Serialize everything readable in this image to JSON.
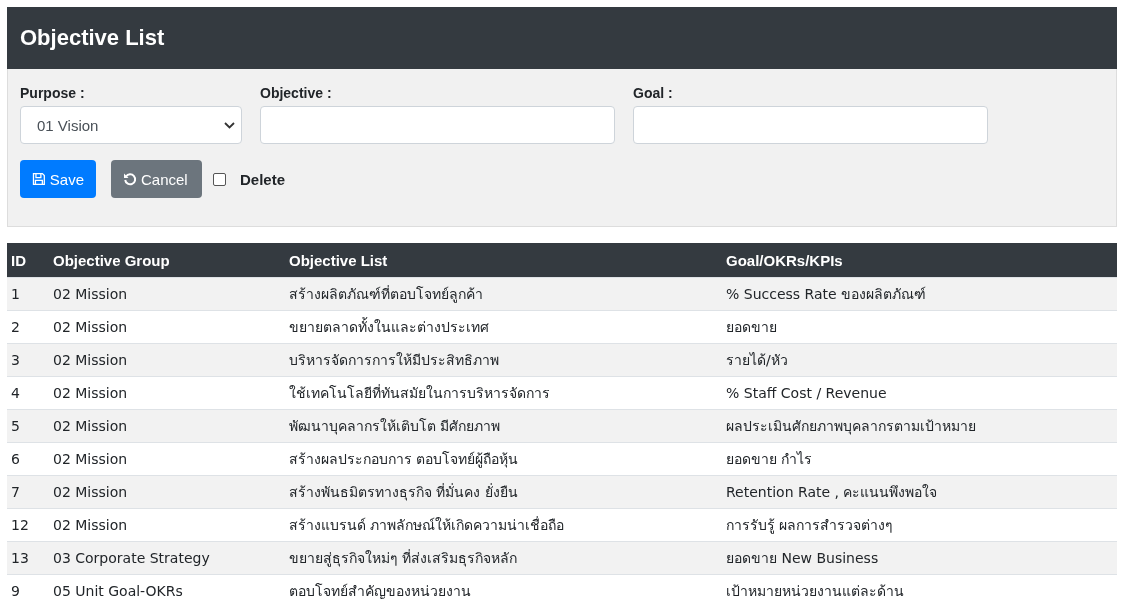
{
  "header": {
    "title": "Objective List"
  },
  "form": {
    "purpose": {
      "label": "Purpose :",
      "value": "01 Vision"
    },
    "objective": {
      "label": "Objective :"
    },
    "goal": {
      "label": "Goal :"
    },
    "save_button": "Save",
    "cancel_button": "Cancel",
    "delete": {
      "label": "Delete",
      "checked": false
    }
  },
  "table": {
    "columns": [
      "ID",
      "Objective Group",
      "Objective List",
      "Goal/OKRs/KPIs"
    ],
    "rows": [
      [
        "1",
        "02 Mission",
        "สร้างผลิตภัณฑ์ที่ตอบโจทย์ลูกค้า",
        "% Success Rate ของผลิตภัณฑ์"
      ],
      [
        "2",
        "02 Mission",
        "ขยายตลาดทั้งในและต่างประเทศ",
        "ยอดขาย"
      ],
      [
        "3",
        "02 Mission",
        "บริหารจัดการการให้มีประสิทธิภาพ",
        "รายได้/หัว"
      ],
      [
        "4",
        "02 Mission",
        "ใช้เทคโนโลยีที่ทันสมัยในการบริหารจัดการ",
        "% Staff Cost / Revenue"
      ],
      [
        "5",
        "02 Mission",
        "พัฒนาบุคลากรให้เติบโต มีศักยภาพ",
        "ผลประเมินศักยภาพบุคลากรตามเป้าหมาย"
      ],
      [
        "6",
        "02 Mission",
        "สร้างผลประกอบการ ตอบโจทย์ผู้ถือหุ้น",
        "ยอดขาย กำไร"
      ],
      [
        "7",
        "02 Mission",
        "สร้างพันธมิตรทางธุรกิจ ที่มั่นคง ยั่งยืน",
        "Retention Rate , คะแนนพึงพอใจ"
      ],
      [
        "12",
        "02 Mission",
        "สร้างแบรนด์ ภาพลักษณ์ให้เกิดความน่าเชื่อถือ",
        "การรับรู้ ผลการสำรวจต่างๆ"
      ],
      [
        "13",
        "03 Corporate Strategy",
        "ขยายสู่ธุรกิจใหม่ๆ ที่ส่งเสริมธุรกิจหลัก",
        "ยอดขาย New Business"
      ],
      [
        "9",
        "05 Unit Goal-OKRs",
        "ตอบโจทย์สำคัญของหน่วยงาน",
        "เป้าหมายหน่วยงานแต่ละด้าน"
      ]
    ]
  }
}
